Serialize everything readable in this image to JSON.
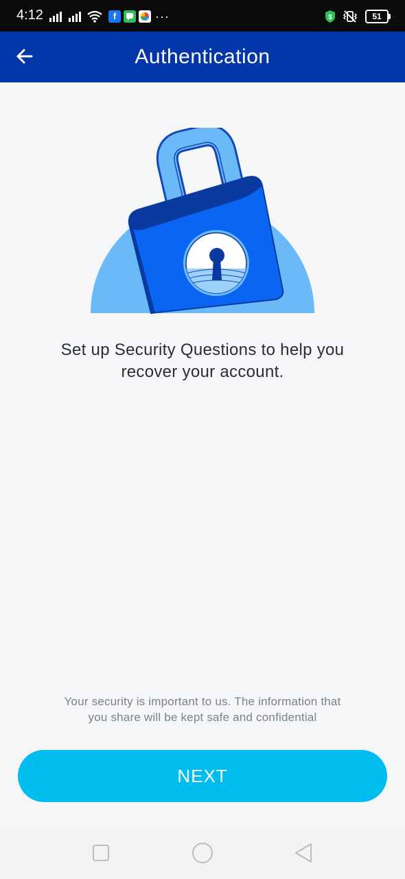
{
  "status_bar": {
    "time": "4:12",
    "more_indicator": "···",
    "battery_level": "51",
    "icons": [
      "signal-icon",
      "signal-icon",
      "wifi-icon",
      "facebook-icon",
      "messages-icon",
      "photos-icon",
      "shield-dollar-icon",
      "vibrate-icon",
      "battery-icon"
    ]
  },
  "app_bar": {
    "title": "Authentication",
    "back_icon": "arrow-left-icon",
    "color": "#0336a8"
  },
  "illustration": {
    "icon": "padlock-icon"
  },
  "main": {
    "message_line1": "Set up Security Questions to help you",
    "message_line2": "recover your account."
  },
  "footer": {
    "note_line1": "Your security is important to us. The information that",
    "note_line2": "you share will be kept safe and confidential"
  },
  "next_button": {
    "label": "NEXT",
    "color": "#00bdf0"
  },
  "nav_bar": {
    "icons": [
      "recents-square-icon",
      "home-circle-icon",
      "back-triangle-icon"
    ]
  }
}
